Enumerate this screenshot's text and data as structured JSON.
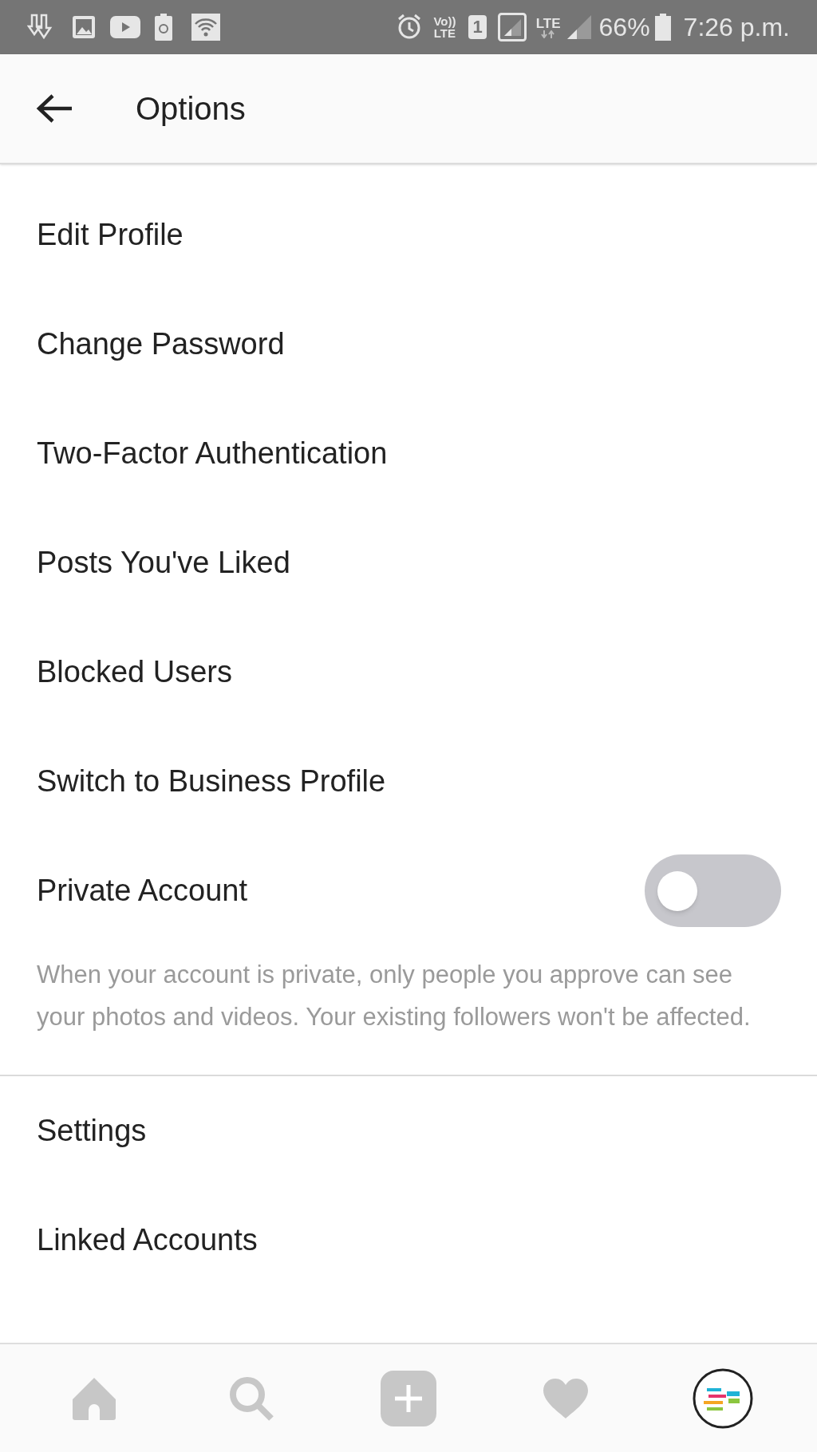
{
  "status_bar": {
    "volte_top": "Vo))",
    "volte_bottom": "LTE",
    "sim": "1",
    "network": "LTE",
    "battery": "66%",
    "time": "7:26 p.m."
  },
  "header": {
    "title": "Options"
  },
  "menu": [
    {
      "kind": "link",
      "label": "Edit Profile"
    },
    {
      "kind": "link",
      "label": "Change Password"
    },
    {
      "kind": "link",
      "label": "Two-Factor Authentication"
    },
    {
      "kind": "link",
      "label": "Posts You've Liked"
    },
    {
      "kind": "link",
      "label": "Blocked Users"
    },
    {
      "kind": "link",
      "label": "Switch to Business Profile"
    },
    {
      "kind": "toggle",
      "label": "Private Account",
      "on": false,
      "description": "When your account is private, only people you approve can see your photos and videos. Your existing followers won't be affected."
    },
    {
      "kind": "divider"
    },
    {
      "kind": "link",
      "label": "Settings"
    },
    {
      "kind": "link",
      "label": "Linked Accounts"
    }
  ],
  "bottom_nav": [
    {
      "kind": "home"
    },
    {
      "kind": "search"
    },
    {
      "kind": "add"
    },
    {
      "kind": "activity"
    },
    {
      "kind": "profile"
    }
  ]
}
